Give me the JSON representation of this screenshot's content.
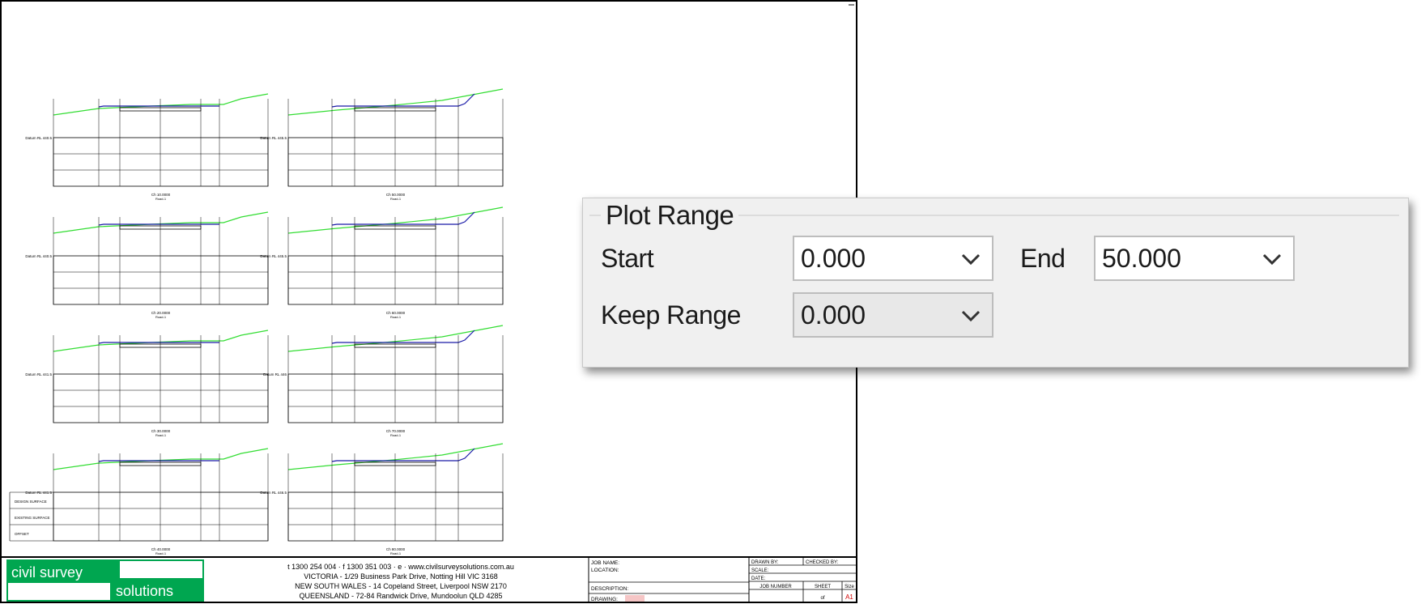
{
  "panel": {
    "group_title": "Plot Range",
    "start": {
      "label": "Start",
      "value": "0.000"
    },
    "end": {
      "label": "End",
      "value": "50.000"
    },
    "keep_range": {
      "label": "Keep Range",
      "value": "0.000"
    }
  },
  "titleblock": {
    "logo_line1": "civil survey",
    "logo_line2": "solutions",
    "contact": "t 1300 254 004 · f 1300 351 003 · e · www.civilsurveysolutions.com.au",
    "address_vic": "VICTORIA - 1/29 Business Park Drive, Notting Hill VIC 3168",
    "address_nsw": "NEW SOUTH WALES - 14 Copeland Street, Liverpool NSW 2170",
    "address_qld": "QUEENSLAND - 72-84 Randwick Drive, Mundoolun QLD 4285",
    "job_name": "JOB NAME:",
    "location": "LOCATION:",
    "description": "DESCRIPTION:",
    "drawing": "DRAWING:",
    "drawn_by": "DRAWN BY:",
    "checked_by": "CHECKED BY:",
    "scale": "SCALE:",
    "date": "DATE:",
    "job_number": "JOB NUMBER",
    "sheet": "SHEET",
    "size": "Size",
    "sheet_of": "of",
    "size_value": "A1"
  },
  "row_labels": [
    "DESIGN SURFACE",
    "EXISTING SURFACE",
    "OFFSET"
  ],
  "sections": [
    {
      "datum": "Datum RL 440.5",
      "caption": "Ch 10.0000",
      "sub": "Road-1"
    },
    {
      "datum": "Datum RL 445.5",
      "caption": "Ch 50.0000",
      "sub": "Road-1"
    },
    {
      "datum": "Datum RL 440.5",
      "caption": "Ch 20.0000",
      "sub": "Road-1"
    },
    {
      "datum": "Datum RL 445.5",
      "caption": "Ch 60.0000",
      "sub": "Road-1"
    },
    {
      "datum": "Datum RL 441.5",
      "caption": "Ch 30.0000",
      "sub": "Road-1"
    },
    {
      "datum": "Datum RL 446",
      "caption": "Ch 70.0000",
      "sub": "Road-1"
    },
    {
      "datum": "Datum RL 441.5",
      "caption": "Ch 40.0000",
      "sub": "Road-1"
    },
    {
      "datum": "Datum RL 446.5",
      "caption": "Ch 80.0000",
      "sub": "Road-1"
    }
  ],
  "colors": {
    "existing_surface": "#33dd33",
    "design_surface": "#1a1aa8",
    "logo_green": "#00a650",
    "panel_bg": "#f0f0f0"
  }
}
